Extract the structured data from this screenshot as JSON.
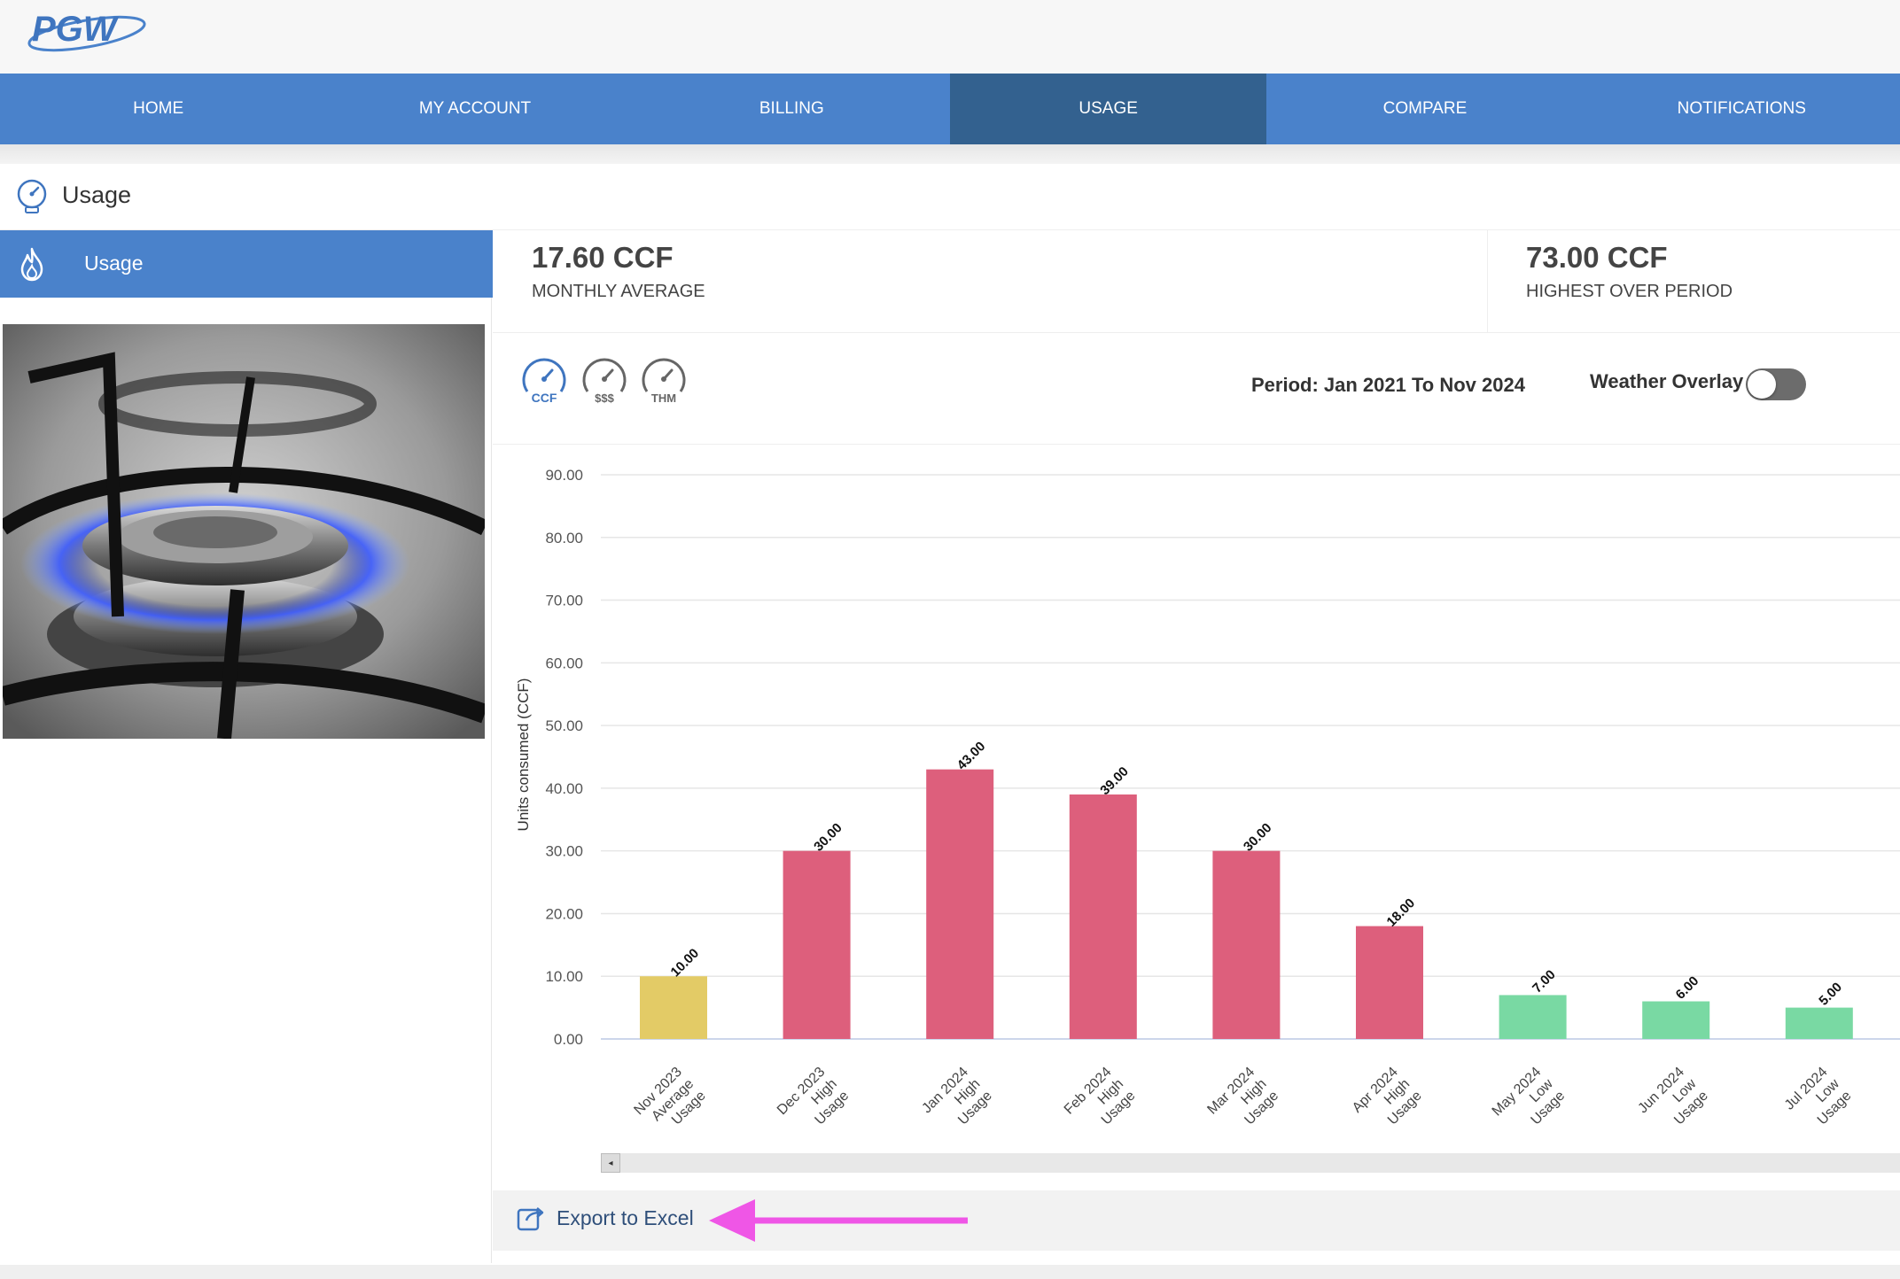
{
  "brand": {
    "logo_text": "PGW"
  },
  "nav": {
    "items": [
      {
        "label": "HOME",
        "active": false
      },
      {
        "label": "MY ACCOUNT",
        "active": false
      },
      {
        "label": "BILLING",
        "active": false
      },
      {
        "label": "USAGE",
        "active": true
      },
      {
        "label": "COMPARE",
        "active": false
      },
      {
        "label": "NOTIFICATIONS",
        "active": false
      }
    ]
  },
  "page": {
    "title": "Usage",
    "icon": "gauge-icon"
  },
  "sidebar": {
    "tab_label": "Usage",
    "tab_icon": "flame-icon",
    "image": "gas-stove-burner-photo"
  },
  "stats": {
    "monthly_average_value": "17.60 CCF",
    "monthly_average_label": "MONTHLY AVERAGE",
    "highest_value": "73.00 CCF",
    "highest_label": "HIGHEST OVER PERIOD"
  },
  "controls": {
    "unit_buttons": [
      {
        "label": "CCF",
        "selected": true
      },
      {
        "label": "$$$",
        "selected": false
      },
      {
        "label": "THM",
        "selected": false
      }
    ],
    "period": "Period: Jan 2021 To Nov 2024",
    "weather_overlay_label": "Weather Overlay",
    "weather_overlay_on": false
  },
  "colors": {
    "nav_bg": "#4a82cb",
    "nav_active": "#33618f",
    "average_usage": "#e3cb66",
    "high_usage": "#dd5f7c",
    "low_usage": "#79d9a3",
    "annotation_arrow": "#ef56e6"
  },
  "chart_data": {
    "type": "bar",
    "ylabel": "Units consumed (CCF)",
    "ylim": [
      0,
      90
    ],
    "yticks": [
      "0.00",
      "10.00",
      "20.00",
      "30.00",
      "40.00",
      "50.00",
      "60.00",
      "70.00",
      "80.00",
      "90.00"
    ],
    "grid": true,
    "categories": [
      [
        "Nov 2023",
        "Average",
        "Usage"
      ],
      [
        "Dec 2023",
        "High",
        "Usage"
      ],
      [
        "Jan 2024",
        "High",
        "Usage"
      ],
      [
        "Feb 2024",
        "High",
        "Usage"
      ],
      [
        "Mar 2024",
        "High",
        "Usage"
      ],
      [
        "Apr 2024",
        "High",
        "Usage"
      ],
      [
        "May 2024",
        "Low",
        "Usage"
      ],
      [
        "Jun 2024",
        "Low",
        "Usage"
      ],
      [
        "Jul 2024",
        "Low",
        "Usage"
      ]
    ],
    "values": [
      10,
      30,
      43,
      39,
      30,
      18,
      7,
      6,
      5
    ],
    "value_labels": [
      "10.00",
      "30.00",
      "43.00",
      "39.00",
      "30.00",
      "18.00",
      "7.00",
      "6.00",
      "5.00"
    ],
    "usage_level": [
      "average",
      "high",
      "high",
      "high",
      "high",
      "high",
      "low",
      "low",
      "low"
    ]
  },
  "export": {
    "label": "Export to Excel",
    "icon": "export-icon"
  }
}
